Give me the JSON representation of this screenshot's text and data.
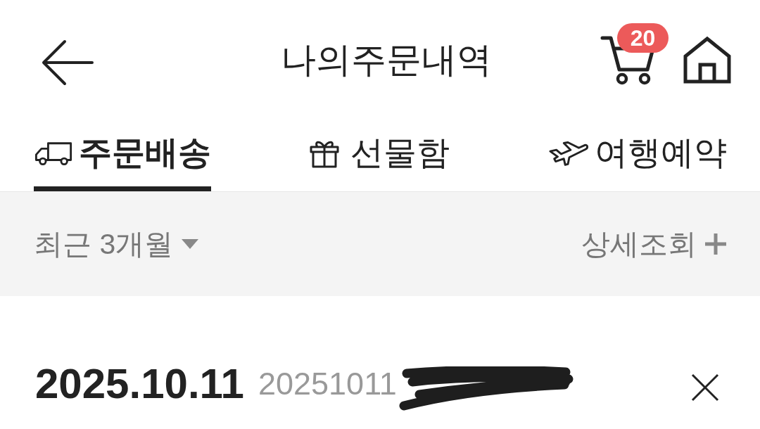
{
  "header": {
    "title": "나의주문내역",
    "cart_badge": "20"
  },
  "tabs": [
    {
      "kind": "delivery",
      "label": "주문배송",
      "selected": true
    },
    {
      "kind": "gift",
      "label": "선물함",
      "selected": false
    },
    {
      "kind": "travel",
      "label": "여행예약",
      "selected": false
    }
  ],
  "filter_bar": {
    "period": "최근 3개월",
    "detail_search": "상세조회"
  },
  "orders": [
    {
      "date": "2025.10.11",
      "order_number": "20251011",
      "redacted": true
    }
  ]
}
